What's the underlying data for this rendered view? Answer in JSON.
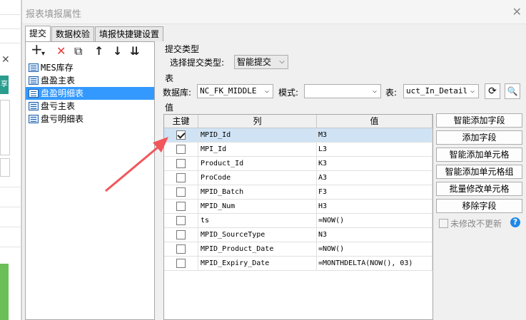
{
  "dialog": {
    "title": "报表填报属性"
  },
  "tabs": [
    {
      "label": "提交",
      "active": true
    },
    {
      "label": "数据校验",
      "active": false
    },
    {
      "label": "填报快捷键设置",
      "active": false
    }
  ],
  "left_background": {
    "tab_glyph": "享"
  },
  "toolbar": {
    "add": "+",
    "add_dropdown": "▾",
    "delete": "✕",
    "copy": "⧉",
    "up": "↑",
    "down": "↓",
    "sort": "⇊"
  },
  "tree": {
    "items": [
      {
        "label": "MES库存",
        "selected": false
      },
      {
        "label": "盘盈主表",
        "selected": false
      },
      {
        "label": "盘盈明细表",
        "selected": true
      },
      {
        "label": "盘亏主表",
        "selected": false
      },
      {
        "label": "盘亏明细表",
        "selected": false
      }
    ]
  },
  "submit_type": {
    "section_label": "提交类型",
    "select_label": "选择提交类型:",
    "value": "智能提交"
  },
  "table_section": {
    "section_label": "表",
    "db_label": "数据库:",
    "db_value": "NC_FK_MIDDLE",
    "schema_label": "模式:",
    "schema_value": "",
    "table_label": "表:",
    "table_value": "uct_In_Detail"
  },
  "value_section": {
    "section_label": "值",
    "headers": {
      "key": "主键",
      "column": "列",
      "value": "值"
    },
    "rows": [
      {
        "key": true,
        "column": "MPID_Id",
        "value": "M3",
        "selected": true
      },
      {
        "key": false,
        "column": "MPI_Id",
        "value": "L3"
      },
      {
        "key": false,
        "column": "Product_Id",
        "value": "K3"
      },
      {
        "key": false,
        "column": "ProCode",
        "value": "A3"
      },
      {
        "key": false,
        "column": "MPID_Batch",
        "value": "F3"
      },
      {
        "key": false,
        "column": "MPID_Num",
        "value": "H3"
      },
      {
        "key": false,
        "column": "ts",
        "value": "=NOW()"
      },
      {
        "key": false,
        "column": "MPID_SourceType",
        "value": "N3"
      },
      {
        "key": false,
        "column": "MPID_Product_Date",
        "value": "=NOW()"
      },
      {
        "key": false,
        "column": "MPID_Expiry_Date",
        "value": "=MONTHDELTA(NOW(), 03)"
      }
    ]
  },
  "actions": {
    "smart_add_field": "智能添加字段",
    "add_field": "添加字段",
    "smart_add_cell": "智能添加单元格",
    "smart_add_cell_group": "智能添加单元格组",
    "batch_modify_cell": "批量修改单元格",
    "remove_field": "移除字段",
    "no_update_unmodified": "未修改不更新",
    "help": "?"
  },
  "colors": {
    "accent": "#3399ff",
    "annotation_arrow": "#f0565a",
    "help": "#1e88e5"
  }
}
